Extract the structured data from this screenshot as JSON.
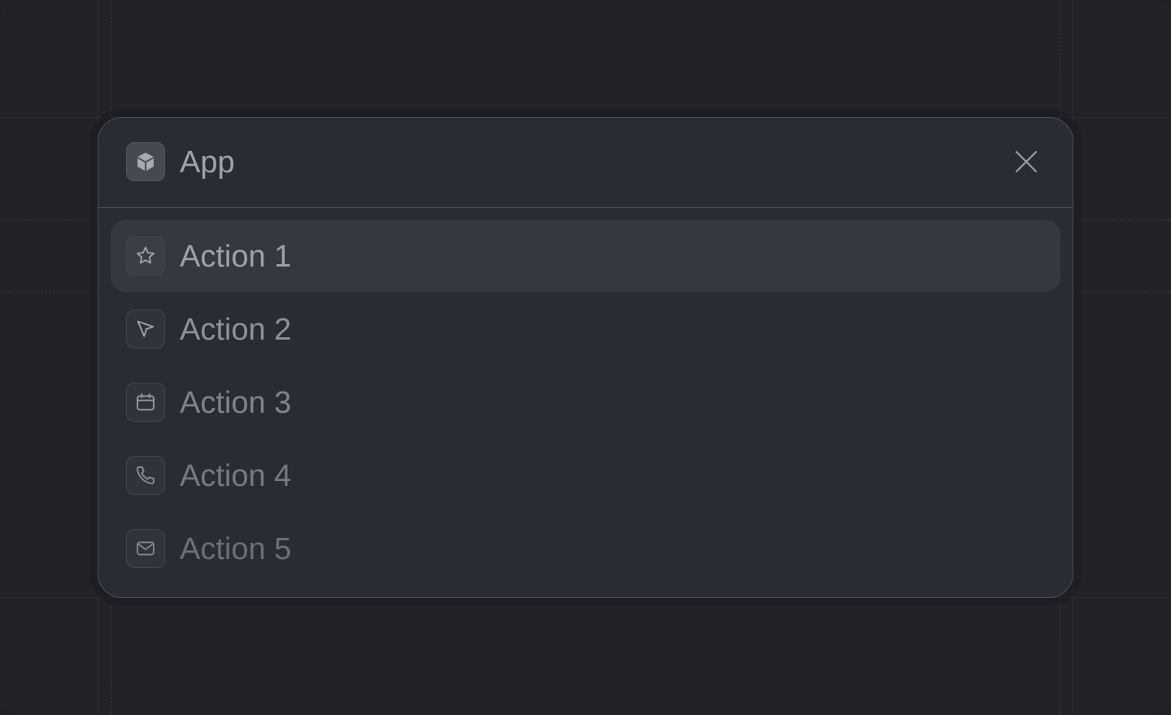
{
  "header": {
    "app_title": "App",
    "app_icon": "cube-icon",
    "close_icon": "close-icon"
  },
  "actions": [
    {
      "label": "Action 1",
      "icon": "star-icon",
      "active": true
    },
    {
      "label": "Action 2",
      "icon": "cursor-arrow-icon",
      "active": false
    },
    {
      "label": "Action 3",
      "icon": "calendar-icon",
      "active": false
    },
    {
      "label": "Action 4",
      "icon": "phone-icon",
      "active": false
    },
    {
      "label": "Action 5",
      "icon": "mail-icon",
      "active": false
    }
  ],
  "colors": {
    "background": "#222328",
    "panel": "#2a2c34",
    "active_item": "#353741",
    "text": "#9fa2ab"
  }
}
